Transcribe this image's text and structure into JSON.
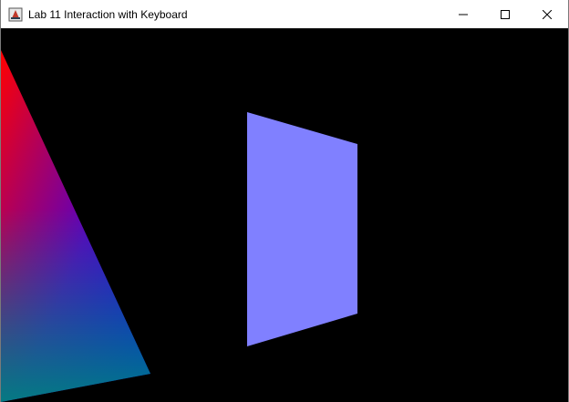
{
  "window": {
    "title": "Lab 11 Interaction with Keyboard",
    "app_icon": "java-icon",
    "controls": {
      "minimize_icon": "minimize-icon",
      "maximize_icon": "maximize-icon",
      "close_icon": "close-icon"
    }
  },
  "scene": {
    "background_color": "#000000",
    "triangle": {
      "colors": [
        "#ff0000",
        "#0000ff",
        "#008080"
      ]
    },
    "quad": {
      "color": "#8080ff"
    }
  }
}
